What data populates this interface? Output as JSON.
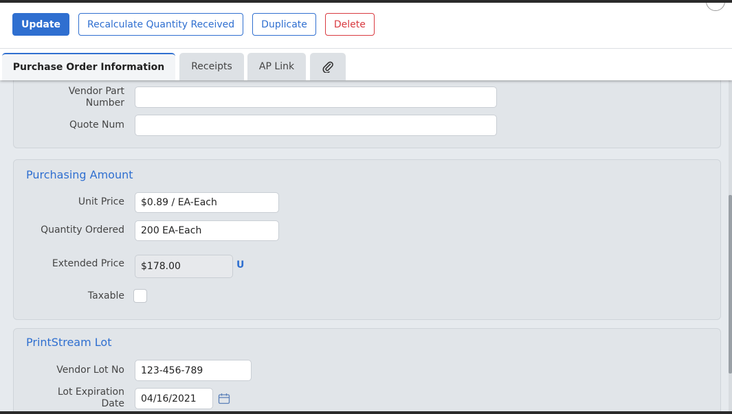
{
  "toolbar": {
    "update_label": "Update",
    "recalculate_label": "Recalculate Quantity Received",
    "duplicate_label": "Duplicate",
    "delete_label": "Delete"
  },
  "tabs": [
    {
      "label": "Purchase Order Information",
      "active": true
    },
    {
      "label": "Receipts",
      "active": false
    },
    {
      "label": "AP Link",
      "active": false
    },
    {
      "label": "",
      "icon": "paperclip-icon",
      "active": false
    }
  ],
  "vendor_section": {
    "vendor_part_number_label_line1": "Vendor Part",
    "vendor_part_number_label_line2": "Number",
    "vendor_part_number_value": "",
    "quote_num_label": "Quote Num",
    "quote_num_value": ""
  },
  "purchasing_amount": {
    "title": "Purchasing Amount",
    "unit_price_label": "Unit Price",
    "unit_price_value": "$0.89 / EA-Each",
    "quantity_ordered_label": "Quantity Ordered",
    "quantity_ordered_value": "200 EA-Each",
    "extended_price_label": "Extended Price",
    "extended_price_value": "$178.00",
    "extended_price_link": "U",
    "taxable_label": "Taxable",
    "taxable_checked": false
  },
  "printstream_lot": {
    "title": "PrintStream Lot",
    "vendor_lot_label": "Vendor Lot No",
    "vendor_lot_value": "123-456-789",
    "lot_expiration_label_line1": "Lot Expiration",
    "lot_expiration_label_line2": "Date",
    "lot_expiration_value": "04/16/2021"
  },
  "colors": {
    "accent": "#2f6fd0",
    "danger": "#d9393f"
  }
}
